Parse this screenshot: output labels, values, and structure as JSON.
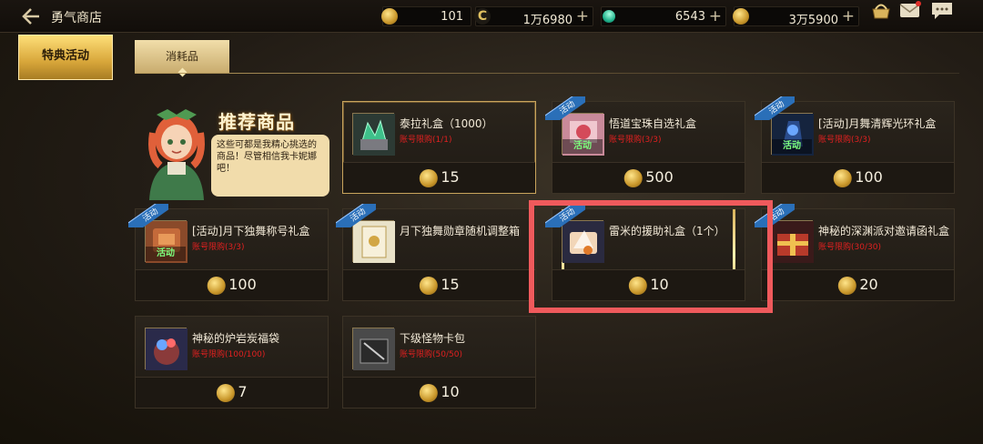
{
  "header": {
    "title": "勇气商店",
    "currencies": [
      {
        "name": "coin",
        "value": "101"
      },
      {
        "name": "c-currency",
        "value": "1万6980"
      },
      {
        "name": "gem",
        "value": "6543"
      },
      {
        "name": "gold-coin",
        "value": "3万5900"
      }
    ],
    "plus": "+",
    "c_glyph": "C"
  },
  "tabs": {
    "left_active": "特典活动",
    "sub_active": "消耗品"
  },
  "recommend": {
    "title": "推荐商品",
    "bubble": "这些可都是我精心挑选的商品！尽管相信我卡妮娜吧！"
  },
  "labels": {
    "event_ribbon": "活动",
    "event_tag": "活动"
  },
  "items": [
    {
      "name": "泰拉礼盒（1000）",
      "limit": "账号限购(1/1)",
      "price": "15",
      "event": false,
      "selected": true
    },
    {
      "name": "悟道宝珠自选礼盒",
      "limit": "账号限购(3/3)",
      "price": "500",
      "event": true
    },
    {
      "name": "[活动]月舞清辉光环礼盒",
      "limit": "账号限购(3/3)",
      "price": "100",
      "event": true
    },
    {
      "name": "[活动]月下独舞称号礼盒",
      "limit": "账号限购(3/3)",
      "price": "100",
      "event": true
    },
    {
      "name": "月下独舞勋章随机调整箱",
      "limit": "",
      "price": "15",
      "event": true
    },
    {
      "name": "雷米的援助礼盒（1个）",
      "limit": "",
      "price": "10",
      "event": true,
      "highlighted": true
    },
    {
      "name": "神秘的深渊派对邀请函礼盒",
      "limit": "账号限购(30/30)",
      "price": "20",
      "event": true
    },
    {
      "name": "神秘的炉岩炭福袋",
      "limit": "账号限购(100/100)",
      "price": "7",
      "event": false
    },
    {
      "name": "下级怪物卡包",
      "limit": "账号限购(50/50)",
      "price": "10",
      "event": false
    }
  ],
  "colors": {
    "accent_gold": "#d8a63a",
    "limit_red": "#e02020",
    "highlight_red": "#ef5a5c",
    "ribbon_blue": "#2a6fb8"
  }
}
